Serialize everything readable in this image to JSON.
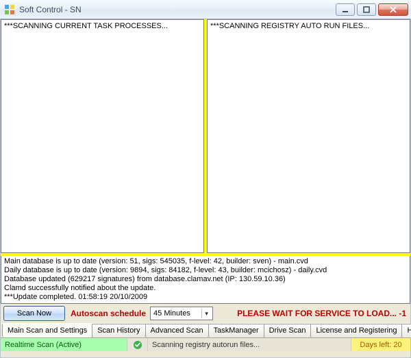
{
  "window": {
    "title": "Soft Control - SN"
  },
  "panels": {
    "left_header": "***SCANNING CURRENT TASK PROCESSES...",
    "right_header": "***SCANNING REGISTRY AUTO RUN FILES..."
  },
  "log_lines": [
    "Main database is up to date (version: 51, sigs: 545035, f-level: 42, builder: sven) - main.cvd",
    "Daily database is up to date (version: 9894, sigs: 84182, f-level: 43, builder: mcichosz) - daily.cvd",
    "Database updated (629217 signatures) from database.clamav.net (IP: 130.59.10.36)",
    "Clamd successfully notified about the update.",
    "***Update completed. 01:58:19 20/10/2009"
  ],
  "controls": {
    "scan_now_label": "Scan Now",
    "autoscan_label": "Autoscan schedule",
    "schedule_value": "45 Minutes",
    "wait_message": "PLEASE WAIT FOR SERVICE TO LOAD... -1"
  },
  "tabs": [
    "Main Scan and Settings",
    "Scan History",
    "Advanced Scan",
    "TaskManager",
    "Drive Scan",
    "License and Registering",
    "Help"
  ],
  "status": {
    "realtime": "Realtime Scan (Active)",
    "scanning": "Scanning registry autorun files...",
    "days_left": "Days left: 20"
  }
}
